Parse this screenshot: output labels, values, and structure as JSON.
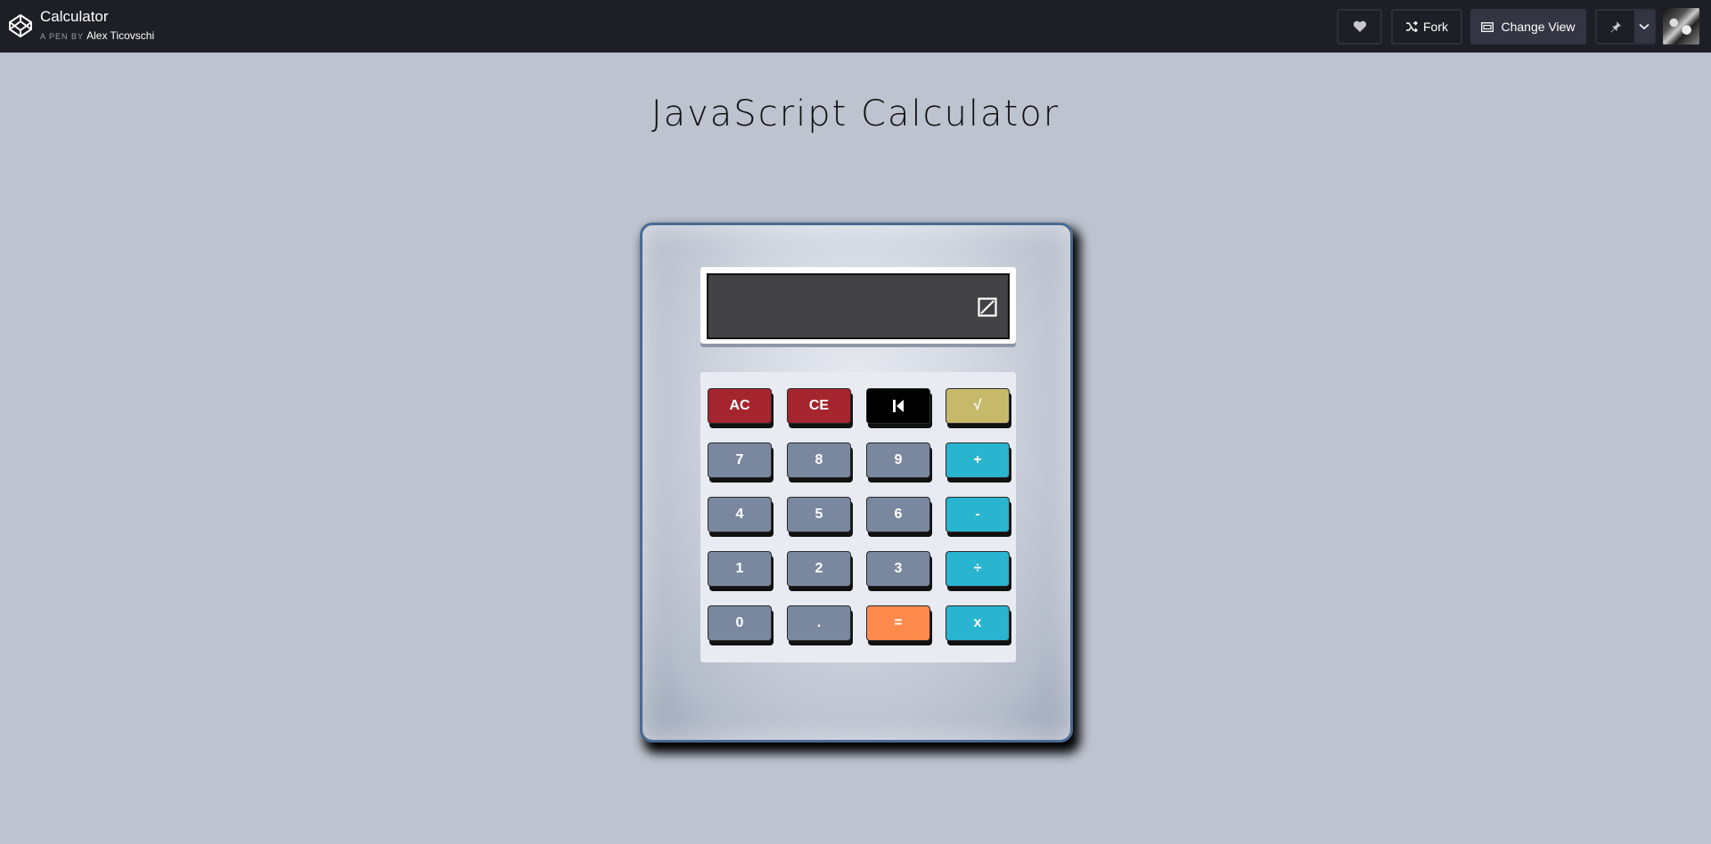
{
  "header": {
    "pen_title": "Calculator",
    "byline_prefix": "A PEN BY",
    "author": "Alex Ticovschi",
    "fork_label": "Fork",
    "change_view_label": "Change View"
  },
  "page": {
    "title": "JavaScript Calculator"
  },
  "calculator": {
    "display_value": "",
    "keys": [
      {
        "label": "AC",
        "color": "#a5252e"
      },
      {
        "label": "CE",
        "color": "#a5252e"
      },
      {
        "label": "backspace",
        "color": "#000000"
      },
      {
        "label": "√",
        "color": "#c7b96a"
      },
      {
        "label": "7",
        "color": "#7a889f"
      },
      {
        "label": "8",
        "color": "#7a889f"
      },
      {
        "label": "9",
        "color": "#7a889f"
      },
      {
        "label": "+",
        "color": "#29b5d0"
      },
      {
        "label": "4",
        "color": "#7a889f"
      },
      {
        "label": "5",
        "color": "#7a889f"
      },
      {
        "label": "6",
        "color": "#7a889f"
      },
      {
        "label": "-",
        "color": "#29b5d0"
      },
      {
        "label": "1",
        "color": "#7a889f"
      },
      {
        "label": "2",
        "color": "#7a889f"
      },
      {
        "label": "3",
        "color": "#7a889f"
      },
      {
        "label": "÷",
        "color": "#29b5d0"
      },
      {
        "label": "0",
        "color": "#7a889f"
      },
      {
        "label": ".",
        "color": "#7a889f"
      },
      {
        "label": "=",
        "color": "#ff8a4c"
      },
      {
        "label": "x",
        "color": "#29b5d0"
      }
    ]
  }
}
